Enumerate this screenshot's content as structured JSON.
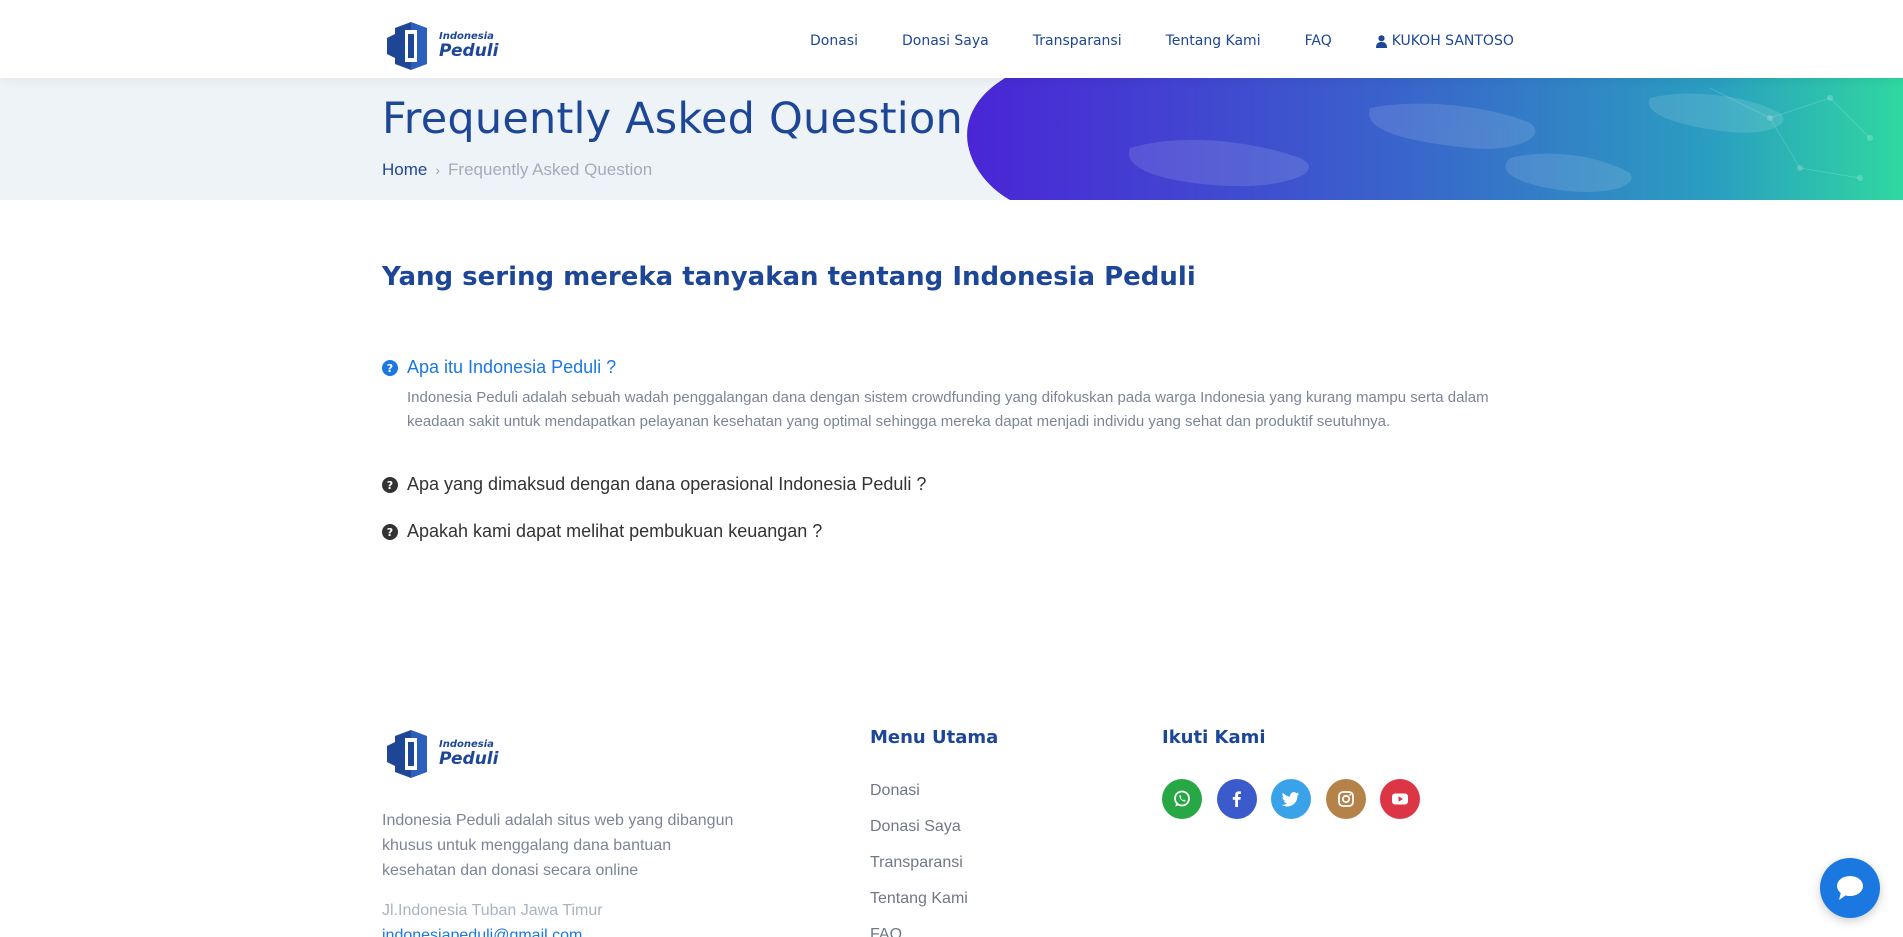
{
  "header": {
    "logo": {
      "line1": "Indonesia",
      "line2": "Peduli"
    },
    "nav": [
      {
        "label": "Donasi"
      },
      {
        "label": "Donasi Saya"
      },
      {
        "label": "Transparansi"
      },
      {
        "label": "Tentang Kami"
      },
      {
        "label": "FAQ"
      }
    ],
    "user": {
      "label": "KUKOH SANTOSO",
      "icon": "user-icon"
    }
  },
  "hero": {
    "title": "Frequently Asked Question",
    "breadcrumb": {
      "home": "Home",
      "separator": "›",
      "current": "Frequently Asked Question"
    }
  },
  "main": {
    "title": "Yang sering mereka tanyakan tentang Indonesia Peduli",
    "faqs": [
      {
        "question": "Apa itu Indonesia Peduli ?",
        "answer": "Indonesia Peduli adalah sebuah wadah penggalangan dana dengan sistem crowdfunding yang difokuskan pada warga Indonesia yang kurang mampu serta dalam keadaan sakit untuk mendapatkan pelayanan kesehatan yang optimal sehingga mereka dapat menjadi individu yang sehat dan produktif seutuhnya.",
        "expanded": true
      },
      {
        "question": "Apa yang dimaksud dengan dana operasional Indonesia Peduli ?",
        "expanded": false
      },
      {
        "question": "Apakah kami dapat melihat pembukuan keuangan ?",
        "expanded": false
      }
    ]
  },
  "footer": {
    "logo": {
      "line1": "Indonesia",
      "line2": "Peduli"
    },
    "description": "Indonesia Peduli adalah situs web yang dibangun khusus untuk menggalang dana bantuan kesehatan dan donasi secara online",
    "address": "Jl.Indonesia Tuban Jawa Timur",
    "email": "indonesiapeduli@gmail.com",
    "menu_title": "Menu Utama",
    "menu": [
      "Donasi",
      "Donasi Saya",
      "Transparansi",
      "Tentang Kami",
      "FAQ"
    ],
    "follow_title": "Ikuti Kami",
    "socials": [
      {
        "name": "whatsapp-icon",
        "color": "#28a745"
      },
      {
        "name": "facebook-icon",
        "color": "#3b5bcc"
      },
      {
        "name": "twitter-icon",
        "color": "#3aa2e8"
      },
      {
        "name": "instagram-icon",
        "color": "#b5824a"
      },
      {
        "name": "youtube-icon",
        "color": "#dc3545"
      }
    ]
  },
  "colors": {
    "brand_dark": "#1d4796",
    "link_blue": "#1a78e0",
    "muted": "#7b8596",
    "hero_bg": "#eef3f7"
  },
  "chat_widget": {
    "icon": "chat-bubble-icon"
  }
}
